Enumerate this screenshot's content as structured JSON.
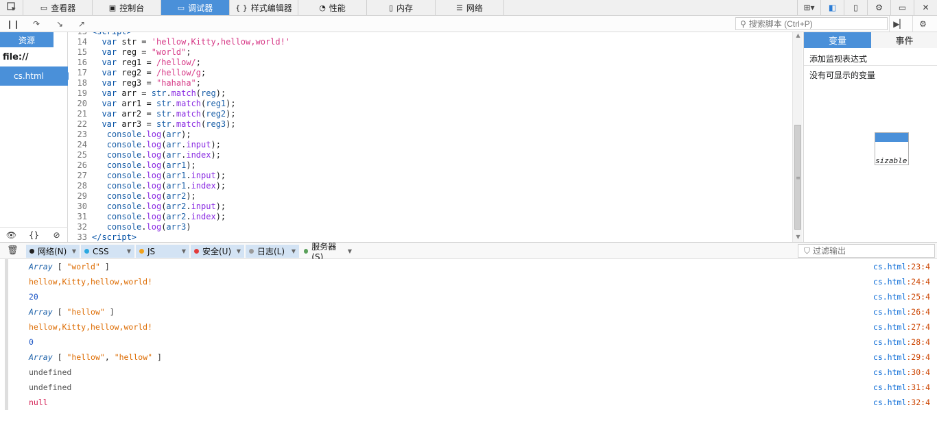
{
  "top_tabs": [
    {
      "label": "查看器",
      "icon": "inspector-icon",
      "glyph": "▭"
    },
    {
      "label": "控制台",
      "icon": "console-icon",
      "glyph": "▣"
    },
    {
      "label": "调试器",
      "icon": "debugger-icon",
      "glyph": "▭",
      "active": true
    },
    {
      "label": "样式编辑器",
      "icon": "style-editor-icon",
      "glyph": "{ }"
    },
    {
      "label": "性能",
      "icon": "performance-icon",
      "glyph": "◔"
    },
    {
      "label": "内存",
      "icon": "memory-icon",
      "glyph": "▯"
    },
    {
      "label": "网络",
      "icon": "network-icon",
      "glyph": "☰"
    }
  ],
  "search": {
    "placeholder": "搜索脚本 (Ctrl+P)"
  },
  "sources": {
    "header": "资源",
    "origin": "file://",
    "file": "cs.html"
  },
  "code_lines": [
    {
      "n": "13",
      "html": "<span class='tag'>&lt;script&gt;</span>"
    },
    {
      "n": "14",
      "html": "  <span class='kw'>var</span> <span class='cm'>str</span> = <span class='str'>'hellow,Kitty,hellow,world!'</span>"
    },
    {
      "n": "15",
      "html": "  <span class='kw'>var</span> <span class='cm'>reg</span> = <span class='str'>\"world\"</span>;"
    },
    {
      "n": "16",
      "html": "  <span class='kw'>var</span> <span class='cm'>reg1</span> = <span class='str'>/hellow/</span>;"
    },
    {
      "n": "17",
      "html": "  <span class='kw'>var</span> <span class='cm'>reg2</span> = <span class='str'>/hellow/g</span>;"
    },
    {
      "n": "18",
      "html": "  <span class='kw'>var</span> <span class='cm'>reg3</span> = <span class='str'>\"hahaha\"</span>;"
    },
    {
      "n": "19",
      "html": "  <span class='kw'>var</span> <span class='cm'>arr</span> = <span class='pl'>str</span>.<span class='fn'>match</span>(<span class='pl'>reg</span>);"
    },
    {
      "n": "20",
      "html": "  <span class='kw'>var</span> <span class='cm'>arr1</span> = <span class='pl'>str</span>.<span class='fn'>match</span>(<span class='pl'>reg1</span>);"
    },
    {
      "n": "21",
      "html": "  <span class='kw'>var</span> <span class='cm'>arr2</span> = <span class='pl'>str</span>.<span class='fn'>match</span>(<span class='pl'>reg2</span>);"
    },
    {
      "n": "22",
      "html": "  <span class='kw'>var</span> <span class='cm'>arr3</span> = <span class='pl'>str</span>.<span class='fn'>match</span>(<span class='pl'>reg3</span>);"
    },
    {
      "n": "23",
      "html": "   <span class='pl'>console</span>.<span class='fn'>log</span>(<span class='pl'>arr</span>);"
    },
    {
      "n": "24",
      "html": "   <span class='pl'>console</span>.<span class='fn'>log</span>(<span class='pl'>arr</span>.<span class='fn'>input</span>);"
    },
    {
      "n": "25",
      "html": "   <span class='pl'>console</span>.<span class='fn'>log</span>(<span class='pl'>arr</span>.<span class='fn'>index</span>);"
    },
    {
      "n": "26",
      "html": "   <span class='pl'>console</span>.<span class='fn'>log</span>(<span class='pl'>arr1</span>);"
    },
    {
      "n": "27",
      "html": "   <span class='pl'>console</span>.<span class='fn'>log</span>(<span class='pl'>arr1</span>.<span class='fn'>input</span>);"
    },
    {
      "n": "28",
      "html": "   <span class='pl'>console</span>.<span class='fn'>log</span>(<span class='pl'>arr1</span>.<span class='fn'>index</span>);"
    },
    {
      "n": "29",
      "html": "   <span class='pl'>console</span>.<span class='fn'>log</span>(<span class='pl'>arr2</span>);"
    },
    {
      "n": "30",
      "html": "   <span class='pl'>console</span>.<span class='fn'>log</span>(<span class='pl'>arr2</span>.<span class='fn'>input</span>);"
    },
    {
      "n": "31",
      "html": "   <span class='pl'>console</span>.<span class='fn'>log</span>(<span class='pl'>arr2</span>.<span class='fn'>index</span>);"
    },
    {
      "n": "32",
      "html": "   <span class='pl'>console</span>.<span class='fn'>log</span>(<span class='pl'>arr3</span>)"
    },
    {
      "n": "33",
      "html": "<span class='tag'>&lt;/script&gt;</span>"
    }
  ],
  "variables": {
    "tab_vars": "变量",
    "tab_events": "事件",
    "watch": "添加监视表达式",
    "empty": "没有可显示的变量",
    "resizable": "sizable-p"
  },
  "filters": [
    {
      "label": "网络(N)",
      "color": "#222222"
    },
    {
      "label": "CSS",
      "color": "#2aa8e0"
    },
    {
      "label": "JS",
      "color": "#f2a21b"
    },
    {
      "label": "安全(U)",
      "color": "#e23b3b"
    },
    {
      "label": "日志(L)",
      "color": "#9b9b9b"
    },
    {
      "label": "服务器(S)",
      "color": "#5aa05a"
    }
  ],
  "output_filter": {
    "placeholder": "过滤输出"
  },
  "console_rows": [
    {
      "html": "<span class='arr-kw'>Array</span> <span class='br'>[</span> <span class='v-orange'>\"world\"</span> <span class='br'>]</span>",
      "file": "cs.html",
      "line": ":23:4"
    },
    {
      "html": "<span class='v-orange'>hellow,Kitty,hellow,world!</span>",
      "file": "cs.html",
      "line": ":24:4"
    },
    {
      "html": "<span class='v-blue'>20</span>",
      "file": "cs.html",
      "line": ":25:4"
    },
    {
      "html": "<span class='arr-kw'>Array</span> <span class='br'>[</span> <span class='v-orange'>\"hellow\"</span> <span class='br'>]</span>",
      "file": "cs.html",
      "line": ":26:4"
    },
    {
      "html": "<span class='v-orange'>hellow,Kitty,hellow,world!</span>",
      "file": "cs.html",
      "line": ":27:4"
    },
    {
      "html": "<span class='v-blue'>0</span>",
      "file": "cs.html",
      "line": ":28:4"
    },
    {
      "html": "<span class='arr-kw'>Array</span> <span class='br'>[</span> <span class='v-orange'>\"hellow\"</span>, <span class='v-orange'>\"hellow\"</span> <span class='br'>]</span>",
      "file": "cs.html",
      "line": ":29:4"
    },
    {
      "html": "<span class='v-gray'>undefined</span>",
      "file": "cs.html",
      "line": ":30:4"
    },
    {
      "html": "<span class='v-gray'>undefined</span>",
      "file": "cs.html",
      "line": ":31:4"
    },
    {
      "html": "<span class='v-red'>null</span>",
      "file": "cs.html",
      "line": ":32:4"
    }
  ]
}
